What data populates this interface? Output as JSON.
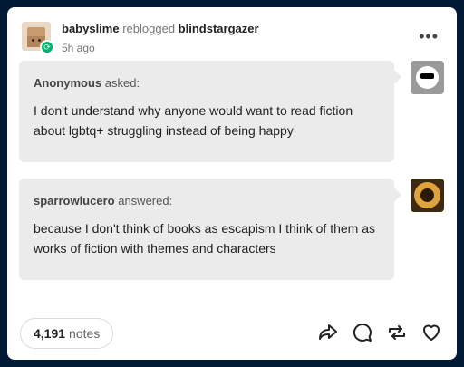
{
  "post": {
    "reblogger": "babyslime",
    "reblog_verb": "reblogged",
    "source_blog": "blindstargazer",
    "timestamp": "5h ago",
    "more_icon": "more-horizontal-icon"
  },
  "ask": {
    "asker": "Anonymous",
    "asker_suffix": "asked:",
    "text": "I don't understand why anyone would want to read fiction about lgbtq+ struggling instead of being happy"
  },
  "answer": {
    "answerer": "sparrowlucero",
    "answerer_suffix": "answered:",
    "text": "because I don't think of books as escapism I think of them as works of fiction with themes and characters"
  },
  "footer": {
    "notes_count": "4,191",
    "notes_label": "notes",
    "actions": [
      "share-icon",
      "reply-icon",
      "reblog-icon",
      "like-icon"
    ]
  },
  "colors": {
    "background": "#001935",
    "bubble": "#ebebeb",
    "reblog_badge": "#00b36b"
  }
}
